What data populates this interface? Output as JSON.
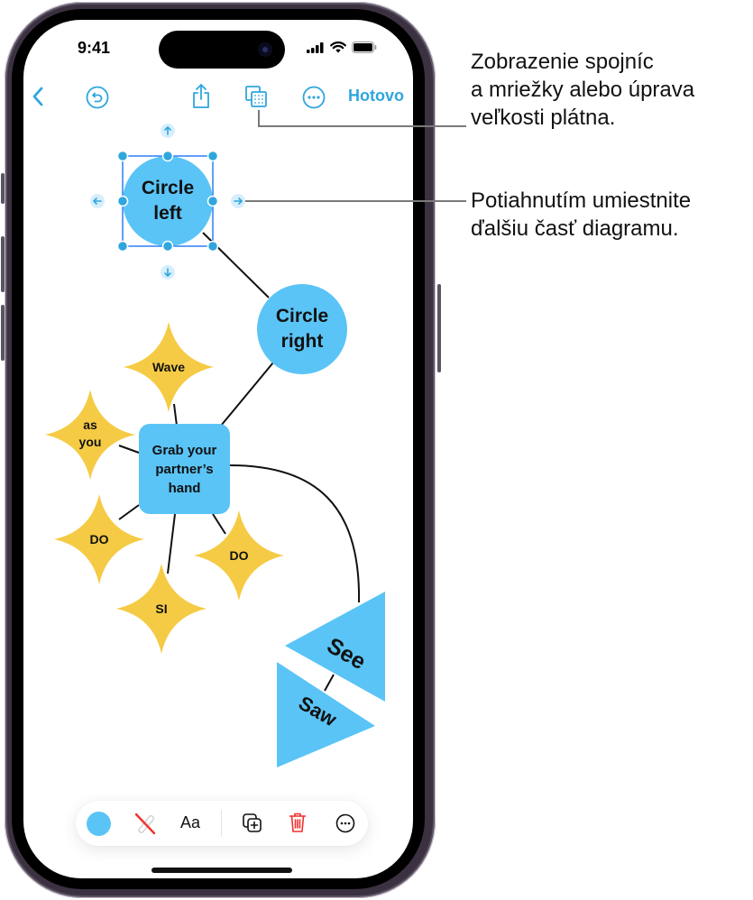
{
  "status_bar": {
    "time": "9:41",
    "icons": [
      "cellular-signal-icon",
      "wifi-icon",
      "battery-icon"
    ]
  },
  "toolbar": {
    "back_icon": "chevron-left-icon",
    "undo_icon": "undo-icon",
    "share_icon": "share-icon",
    "canvas_options_icon": "grid-canvas-icon",
    "more_icon": "ellipsis-circle-icon",
    "done_label": "Hotovo",
    "accent_color": "#2fa6dd"
  },
  "callouts": [
    {
      "lines": [
        "Zobrazenie spojníc",
        "a mriežky alebo úprava",
        "veľkosti plátna."
      ]
    },
    {
      "lines": [
        "Potiahnutím umiestnite",
        "ďalšiu časť diagramu."
      ]
    }
  ],
  "diagram": {
    "colors": {
      "blue": "#5ac4f6",
      "yellow": "#f5cb45",
      "selection": "#2f7ff5",
      "connector": "#111111"
    },
    "nodes": [
      {
        "id": "circle-left",
        "shape": "circle",
        "lines": [
          "Circle",
          "left"
        ],
        "selected": true
      },
      {
        "id": "circle-right",
        "shape": "circle",
        "lines": [
          "Circle",
          "right"
        ]
      },
      {
        "id": "grab",
        "shape": "rounded-rect",
        "lines": [
          "Grab your",
          "partner’s",
          "hand"
        ]
      },
      {
        "id": "wave",
        "shape": "star",
        "lines": [
          "Wave"
        ]
      },
      {
        "id": "as-you",
        "shape": "star",
        "lines": [
          "as",
          "you"
        ]
      },
      {
        "id": "do-left",
        "shape": "star",
        "lines": [
          "DO"
        ]
      },
      {
        "id": "si",
        "shape": "star",
        "lines": [
          "SI"
        ]
      },
      {
        "id": "do-right",
        "shape": "star",
        "lines": [
          "DO"
        ]
      },
      {
        "id": "see",
        "shape": "triangle",
        "lines": [
          "See"
        ]
      },
      {
        "id": "saw",
        "shape": "triangle",
        "lines": [
          "Saw"
        ]
      }
    ],
    "add_arrows": [
      "up",
      "left",
      "right",
      "down"
    ]
  },
  "bottom_toolbar": {
    "fill_color": "#5ac4f6",
    "items": [
      {
        "name": "fill-color-button",
        "icon": "color-swatch-icon"
      },
      {
        "name": "stroke-button",
        "icon": "no-stroke-icon"
      },
      {
        "name": "text-style-button",
        "label": "Aa"
      },
      {
        "name": "duplicate-button",
        "icon": "duplicate-icon"
      },
      {
        "name": "delete-button",
        "icon": "trash-icon",
        "color": "#f0312d"
      },
      {
        "name": "more-button",
        "icon": "ellipsis-circle-icon"
      }
    ]
  }
}
